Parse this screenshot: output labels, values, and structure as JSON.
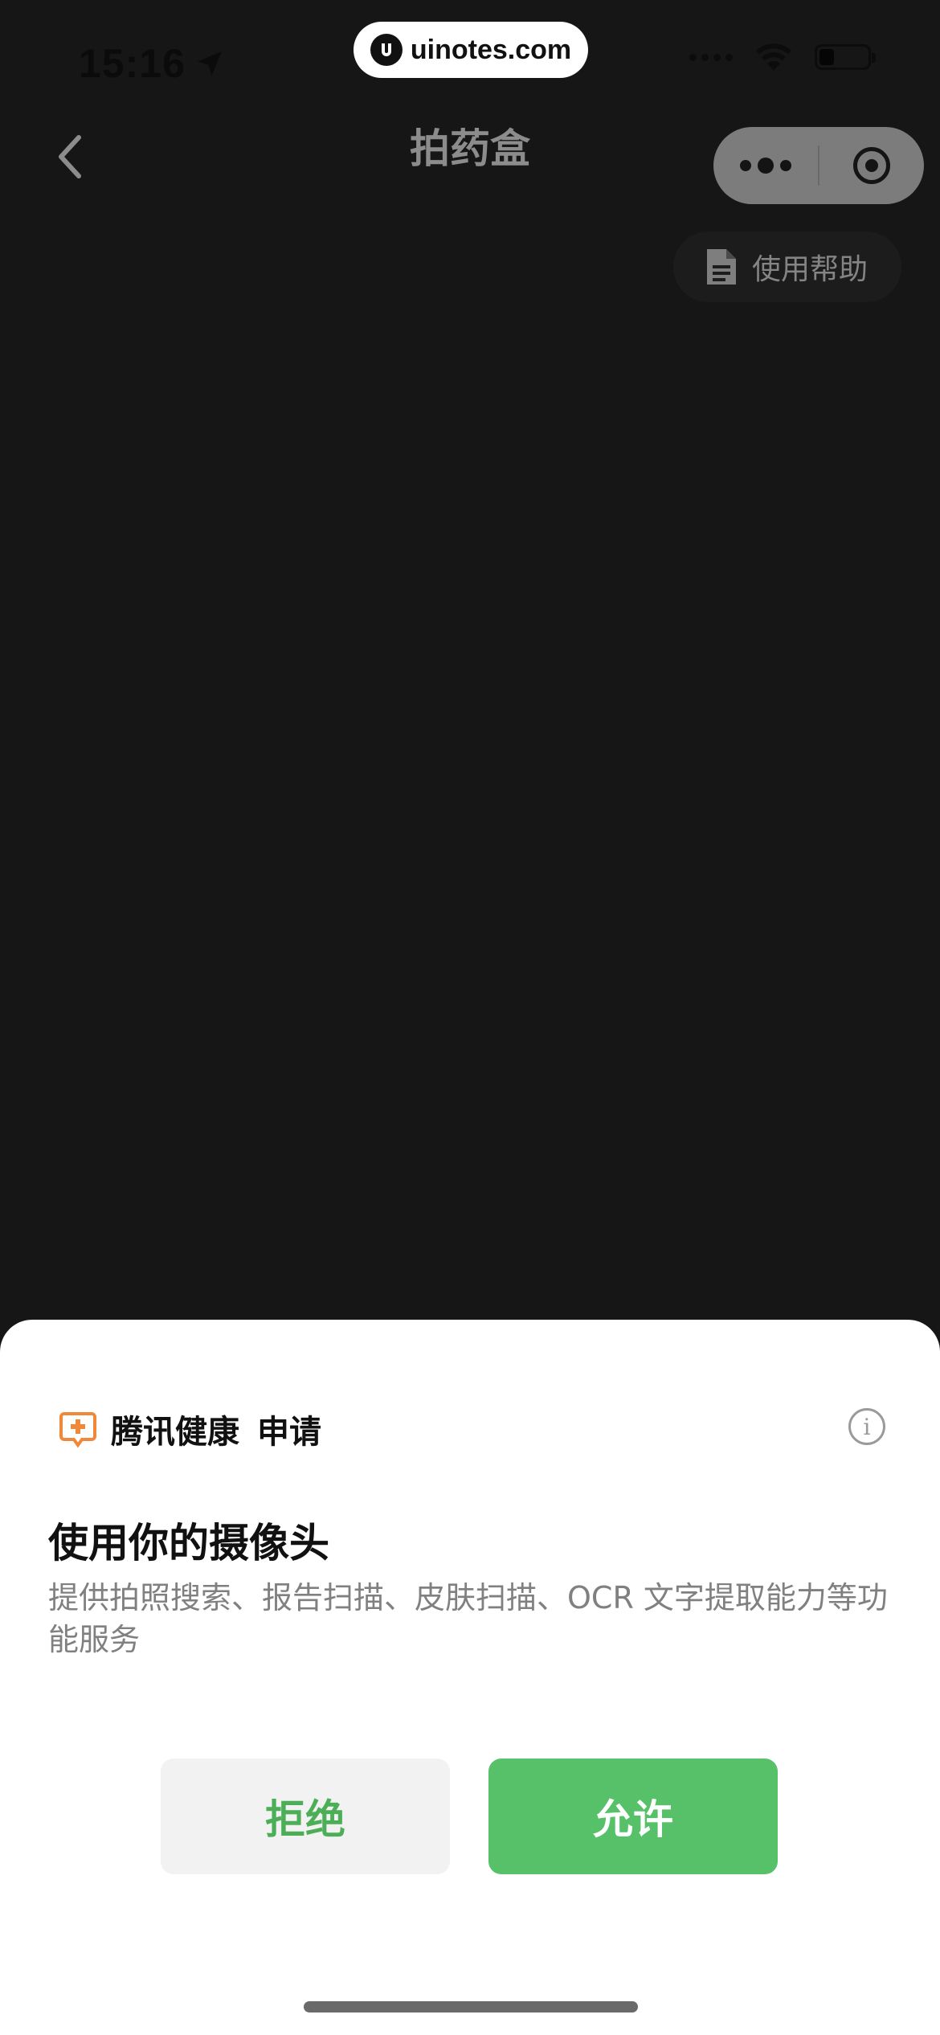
{
  "status_bar": {
    "time": "15:16",
    "watermark": "uinotes.com"
  },
  "nav": {
    "title": "拍药盒",
    "help_label": "使用帮助"
  },
  "permission_sheet": {
    "app_name": "腾讯健康",
    "request_label": "申请",
    "title": "使用你的摄像头",
    "description": "提供拍照搜索、报告扫描、皮肤扫描、OCR 文字提取能力等功能服务",
    "deny_label": "拒绝",
    "allow_label": "允许",
    "info_glyph": "i"
  },
  "colors": {
    "background": "#161616",
    "sheet": "#ffffff",
    "accent_green": "#56c169",
    "deny_text": "#4caf58",
    "app_icon_orange": "#f0883a"
  },
  "icons": {
    "back": "chevron-left-icon",
    "location": "location-arrow-icon",
    "wifi": "wifi-icon",
    "battery": "battery-icon",
    "more": "more-dots-icon",
    "close": "target-close-icon",
    "help": "document-icon",
    "app": "tencent-health-icon",
    "info": "info-icon"
  }
}
